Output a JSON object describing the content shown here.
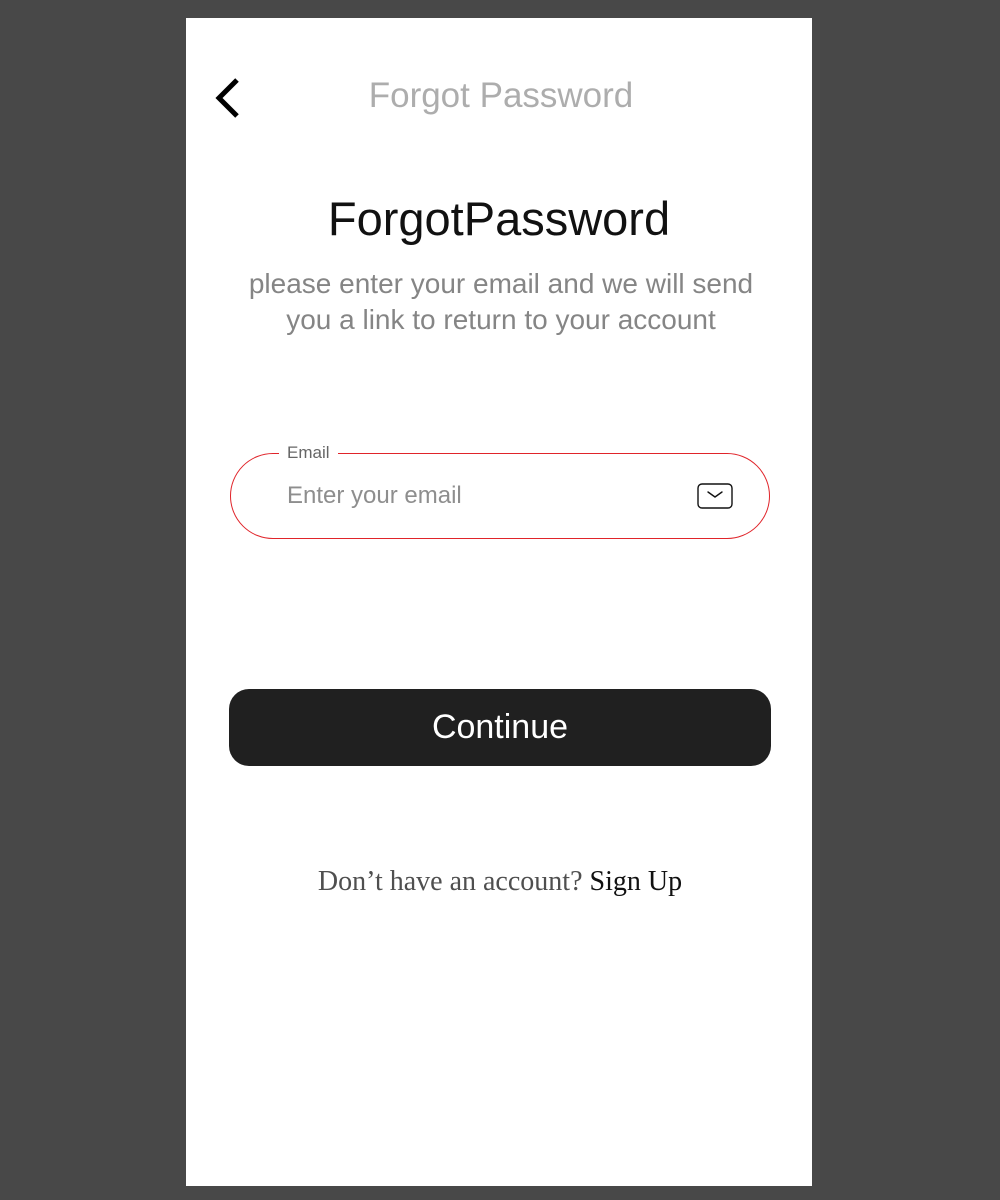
{
  "header": {
    "title": "Forgot Password",
    "back_icon": "chevron-left-icon"
  },
  "main": {
    "title": "ForgotPassword",
    "subtitle_lines": [
      "please enter your email and we will send",
      "you a link to return to your account"
    ]
  },
  "email_field": {
    "label": "Email",
    "placeholder": "Enter your email",
    "value": "",
    "icon": "envelope-icon"
  },
  "continue_button": {
    "label": "Continue"
  },
  "signup": {
    "prompt": "Don’t have an account? ",
    "link": "Sign Up"
  },
  "colors": {
    "page_background": "#484848",
    "screen_background": "#ffffff",
    "field_border": "#e0242a",
    "button_background": "#202020",
    "button_text": "#ffffff",
    "header_title": "#adadad",
    "subtitle_text": "#858585"
  }
}
